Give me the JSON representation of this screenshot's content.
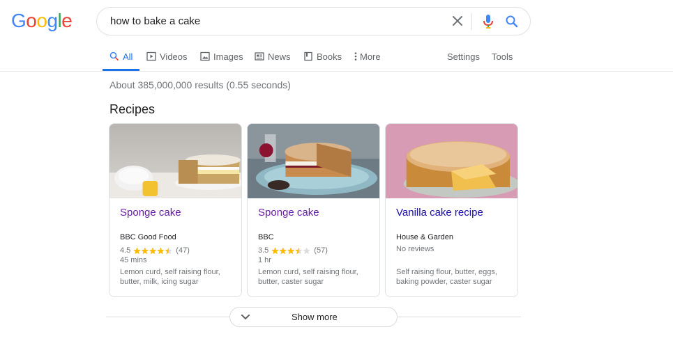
{
  "logo": {
    "letters": [
      "G",
      "o",
      "o",
      "g",
      "l",
      "e"
    ],
    "colors": [
      "#4285f4",
      "#ea4335",
      "#fbbc05",
      "#4285f4",
      "#34a853",
      "#ea4335"
    ]
  },
  "search": {
    "query": "how to bake a cake",
    "clear_icon": "close-icon",
    "mic_icon": "mic-icon",
    "search_icon": "search-icon"
  },
  "tabs": [
    {
      "label": "All",
      "icon": "search-icon",
      "active": true
    },
    {
      "label": "Videos",
      "icon": "video-icon"
    },
    {
      "label": "Images",
      "icon": "image-icon"
    },
    {
      "label": "News",
      "icon": "news-icon"
    },
    {
      "label": "Books",
      "icon": "book-icon"
    },
    {
      "label": "More",
      "icon": "more-vertical-icon"
    },
    {
      "label": "Settings"
    },
    {
      "label": "Tools"
    }
  ],
  "results_count": "About 385,000,000 results (0.55 seconds)",
  "section_title": "Recipes",
  "cards": [
    {
      "title": "Sponge cake",
      "source": "BBC Good Food",
      "rating": "4.5",
      "rating_value": 4.5,
      "reviews": "(47)",
      "time": "45 mins",
      "ingredients": "Lemon curd, self raising flour, butter, milk, icing sugar"
    },
    {
      "title": "Sponge cake",
      "source": "BBC",
      "rating": "3.5",
      "rating_value": 3.5,
      "reviews": "(57)",
      "time": "1 hr",
      "ingredients": "Lemon curd, self raising flour, butter, caster sugar"
    },
    {
      "title": "Vanilla cake recipe",
      "source": "House & Garden",
      "no_reviews": "No reviews",
      "ingredients": "Self raising flour, butter, eggs, baking powder, caster sugar"
    }
  ],
  "show_more": {
    "label": "Show more",
    "icon": "chevron-down-icon"
  },
  "colors": {
    "accent": "#1a73e8",
    "visited_link": "#681da8",
    "link": "#1a0dab",
    "star": "#fbbc04",
    "star_empty": "#dadce0"
  }
}
